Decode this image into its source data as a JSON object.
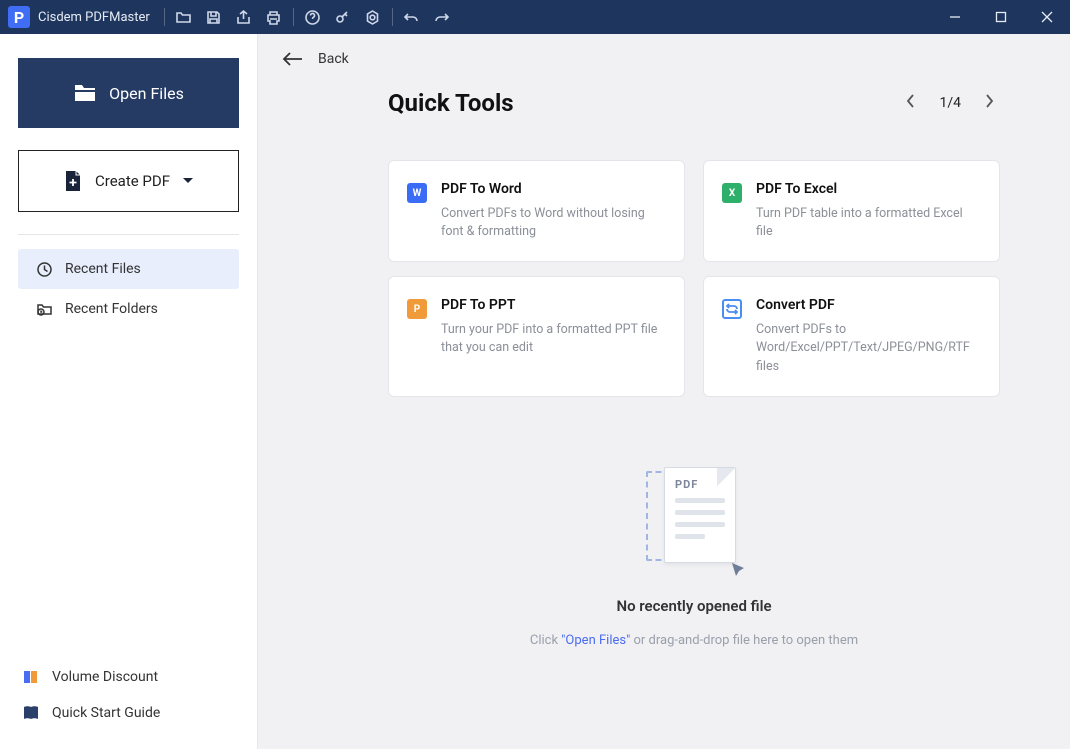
{
  "app": {
    "title": "Cisdem PDFMaster",
    "logo_letter": "P"
  },
  "sidebar": {
    "open_files": "Open Files",
    "create_pdf": "Create PDF",
    "nav": [
      {
        "label": "Recent Files"
      },
      {
        "label": "Recent Folders"
      }
    ],
    "bottom": [
      {
        "label": "Volume Discount"
      },
      {
        "label": "Quick Start Guide"
      }
    ]
  },
  "back": "Back",
  "page_title": "Quick Tools",
  "pager": {
    "current": 1,
    "total": 4,
    "display": "1/4"
  },
  "cards": [
    {
      "title": "PDF To Word",
      "desc": "Convert PDFs to Word without losing font & formatting",
      "icon_color": "#3b6cf6",
      "icon_letter": "W"
    },
    {
      "title": "PDF To Excel",
      "desc": "Turn PDF table into a formatted Excel file",
      "icon_color": "#2fb06a",
      "icon_letter": "X"
    },
    {
      "title": "PDF To PPT",
      "desc": "Turn your PDF into a formatted PPT file that you can edit",
      "icon_color": "#f09a3a",
      "icon_letter": "P"
    },
    {
      "title": "Convert PDF",
      "desc": "Convert PDFs to Word/Excel/PPT/Text/JPEG/PNG/RTF files",
      "icon_color": "#4a8df3",
      "icon_letter": ""
    }
  ],
  "empty": {
    "doc_label": "PDF",
    "title": "No recently opened file",
    "sub_before": "Click ",
    "sub_link": "\"Open Files\"",
    "sub_after": " or drag-and-drop file here to open them"
  }
}
